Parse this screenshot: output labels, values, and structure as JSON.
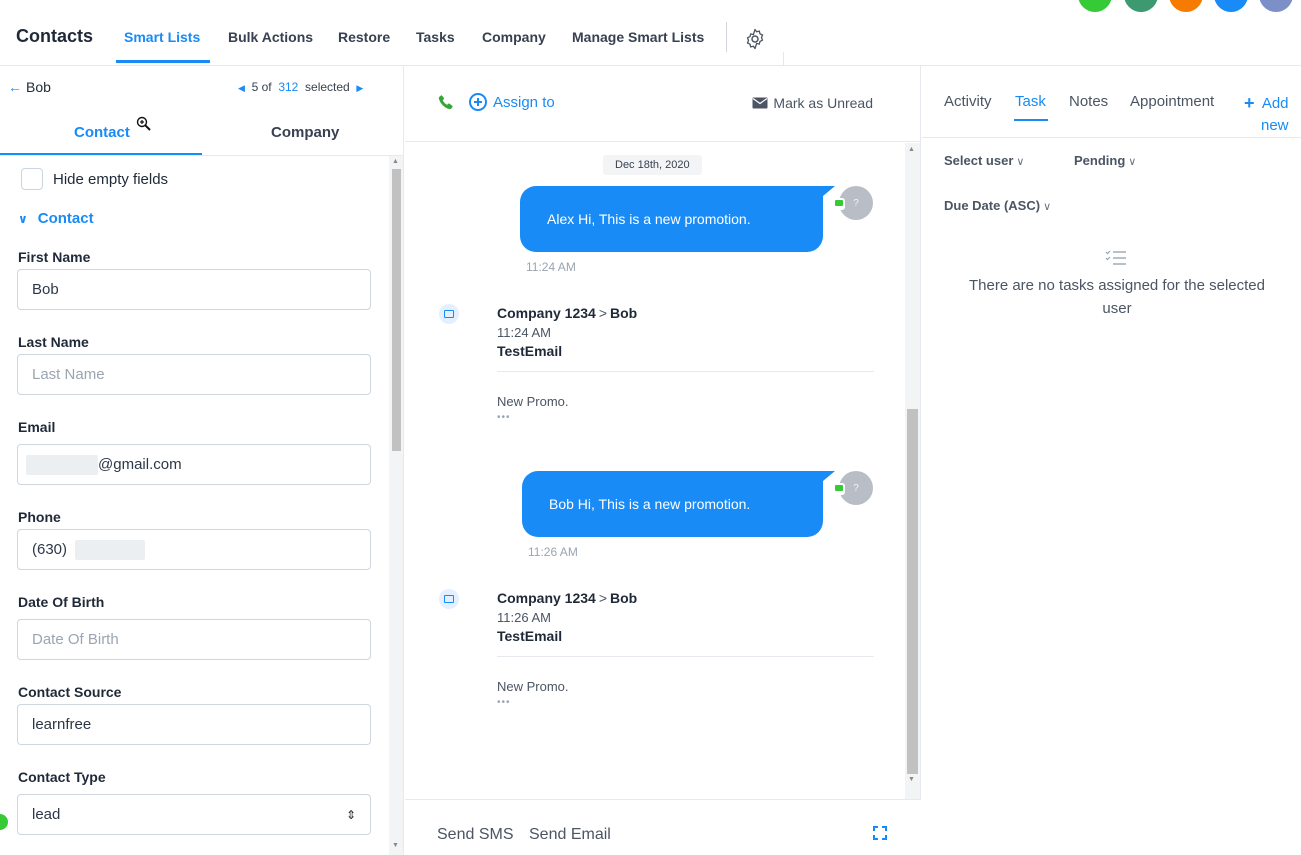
{
  "topnav": {
    "title": "Contacts",
    "items": [
      {
        "label": "Smart Lists",
        "active": true
      },
      {
        "label": "Bulk Actions"
      },
      {
        "label": "Restore"
      },
      {
        "label": "Tasks"
      },
      {
        "label": "Company"
      },
      {
        "label": "Manage Smart Lists"
      }
    ],
    "avatar_colors": [
      "#37ca37",
      "#3d9970",
      "#f57c00",
      "#188bf6",
      "#7c8fc7"
    ]
  },
  "left": {
    "back_label": "Bob",
    "pager": {
      "current": "5",
      "of_label": "of",
      "total": "312",
      "selected_label": "selected"
    },
    "tabs": [
      {
        "label": "Contact",
        "active": true
      },
      {
        "label": "Company"
      }
    ],
    "hide_empty_label": "Hide empty fields",
    "section_label": "Contact",
    "fields": {
      "first_name": {
        "label": "First Name",
        "value": "Bob",
        "placeholder": ""
      },
      "last_name": {
        "label": "Last Name",
        "value": "",
        "placeholder": "Last Name"
      },
      "email": {
        "label": "Email",
        "value": "@gmail.com"
      },
      "phone": {
        "label": "Phone",
        "value": "(630)"
      },
      "dob": {
        "label": "Date Of Birth",
        "value": "",
        "placeholder": "Date Of Birth"
      },
      "source": {
        "label": "Contact Source",
        "value": "learnfree"
      },
      "type": {
        "label": "Contact Type",
        "value": "lead"
      }
    }
  },
  "middle": {
    "assign_label": "Assign to",
    "mark_unread_label": "Mark as Unread",
    "date_chip": "Dec 18th, 2020",
    "messages": [
      {
        "text": "Alex Hi, This is a new promotion.",
        "time": "11:24 AM",
        "avatar": "?"
      },
      {
        "text": "Bob Hi, This is a new promotion.",
        "time": "11:26 AM",
        "avatar": "?"
      }
    ],
    "emails": [
      {
        "from": "Company 1234",
        "to": "Bob",
        "time": "11:24 AM",
        "subject": "TestEmail",
        "body": "New Promo.",
        "more": "•••"
      },
      {
        "from": "Company 1234",
        "to": "Bob",
        "time": "11:26 AM",
        "subject": "TestEmail",
        "body": "New Promo.",
        "more": "•••"
      }
    ],
    "footer": {
      "send_sms": "Send SMS",
      "send_email": "Send Email"
    }
  },
  "right": {
    "tabs": [
      {
        "label": "Activity"
      },
      {
        "label": "Task",
        "active": true
      },
      {
        "label": "Notes"
      },
      {
        "label": "Appointment"
      }
    ],
    "add_label": "Add new",
    "add_line1": "Add",
    "add_line2": "new",
    "filters": {
      "user": "Select user",
      "status": "Pending",
      "sort": "Due Date (ASC)"
    },
    "empty_text": "There are no tasks assigned for the selected user"
  },
  "colors": {
    "accent": "#188bf6",
    "success": "#37ca37"
  }
}
